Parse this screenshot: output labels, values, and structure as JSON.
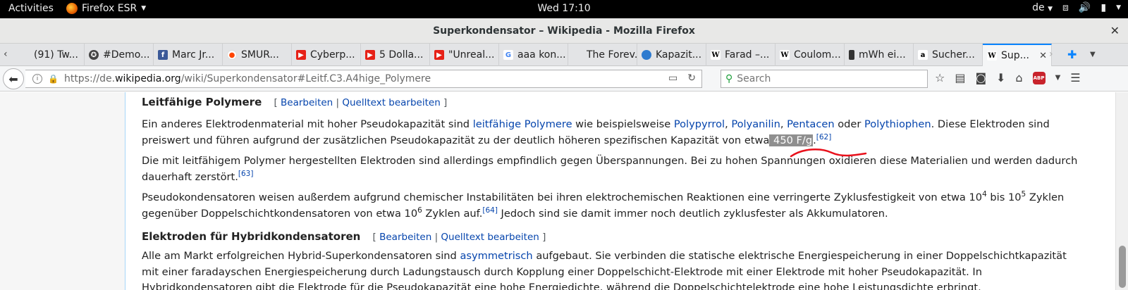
{
  "topbar": {
    "activities": "Activities",
    "app": "Firefox ESR",
    "clock": "Wed 17:10",
    "lang": "de"
  },
  "window": {
    "title": "Superkondensator – Wikipedia - Mozilla Firefox"
  },
  "tabs": [
    {
      "label": "(91) Tw...",
      "icon": "none"
    },
    {
      "label": "#Demo...",
      "icon": "gear"
    },
    {
      "label": "Marc Jr...",
      "icon": "facebook"
    },
    {
      "label": "SMUR...",
      "icon": "reddit"
    },
    {
      "label": "Cyberp...",
      "icon": "youtube"
    },
    {
      "label": "5 Dolla...",
      "icon": "youtube"
    },
    {
      "label": "\"Unreal...",
      "icon": "youtube"
    },
    {
      "label": "aaa kon...",
      "icon": "google"
    },
    {
      "label": "The Forev...",
      "icon": "none"
    },
    {
      "label": "Kapazit...",
      "icon": "globe"
    },
    {
      "label": "Farad –...",
      "icon": "wikipedia"
    },
    {
      "label": "Coulom...",
      "icon": "wikipedia"
    },
    {
      "label": "mWh ei...",
      "icon": "battery"
    },
    {
      "label": "Sucher...",
      "icon": "amazon"
    },
    {
      "label": "Sup...",
      "icon": "wikipedia",
      "active": true
    }
  ],
  "nav": {
    "url_prefix": "https://de.",
    "url_domain": "wikipedia.org",
    "url_suffix": "/wiki/Superkondensator#Leitf.C3.A4hige_Polymere",
    "search_placeholder": "Search",
    "abp_label": "ABP"
  },
  "article": {
    "section1": {
      "heading": "Leitfähige Polymere",
      "edit": "Bearbeiten",
      "edit_source": "Quelltext bearbeiten",
      "p1": {
        "t1": "Ein anderes Elektrodenmaterial mit hoher Pseudokapazität sind ",
        "l1": "leitfähige Polymere",
        "t2": " wie beispielsweise ",
        "l2": "Polypyrrol",
        "t3": ", ",
        "l3": "Polyanilin",
        "t4": ", ",
        "l4": "Pentacen",
        "t5": " oder ",
        "l5": "Polythiophen",
        "t6": ". Diese Elektroden sind preiswert und führen aufgrund der zusätzlichen Pseudokapazität zu der deutlich höheren spezifischen Kapazität von etwa",
        "highlight": " 450 F/g",
        "t7": ".",
        "ref": "[62]"
      },
      "p2": {
        "text": "Die mit leitfähigem Polymer hergestellten Elektroden sind allerdings empfindlich gegen Überspannungen. Bei zu hohen Spannungen oxidieren diese Materialien und werden dadurch dauerhaft zerstört.",
        "ref": "[63]"
      },
      "p3": {
        "t1": "Pseudokondensatoren weisen außerdem aufgrund chemischer Instabilitäten bei ihren elektrochemischen Reaktionen eine verringerte Zyklusfestigkeit von etwa 10",
        "e1": "4",
        "t2": " bis 10",
        "e2": "5",
        "t3": " Zyklen gegenüber Doppelschichtkondensatoren von etwa 10",
        "e3": "6",
        "t4": " Zyklen auf.",
        "ref": "[64]",
        "t5": " Jedoch sind sie damit immer noch deutlich zyklusfester als Akkumulatoren."
      }
    },
    "section2": {
      "heading": "Elektroden für Hybridkondensatoren",
      "edit": "Bearbeiten",
      "edit_source": "Quelltext bearbeiten",
      "p1": {
        "t1": "Alle am Markt erfolgreichen Hybrid-Superkondensatoren sind ",
        "l1": "asymmetrisch",
        "t2": " aufgebaut. Sie verbinden die statische elektrische Energiespeicherung in einer Doppelschichtkapazität mit einer faradayschen Energiespeicherung durch Ladungstausch durch Kopplung einer Doppelschicht-Elektrode mit einer Elektrode mit hoher Pseudokapazität. In Hybridkondensatoren gibt die Elektrode für die Pseudokapazität eine hohe Energiedichte, während die Doppelschichtelektrode eine hohe Leistungsdichte erbringt."
      }
    }
  },
  "colors": {
    "link": "#0645ad",
    "annotation": "#e8101b",
    "highlight": "#8f8f8f",
    "tab_accent": "#0a84ff"
  }
}
